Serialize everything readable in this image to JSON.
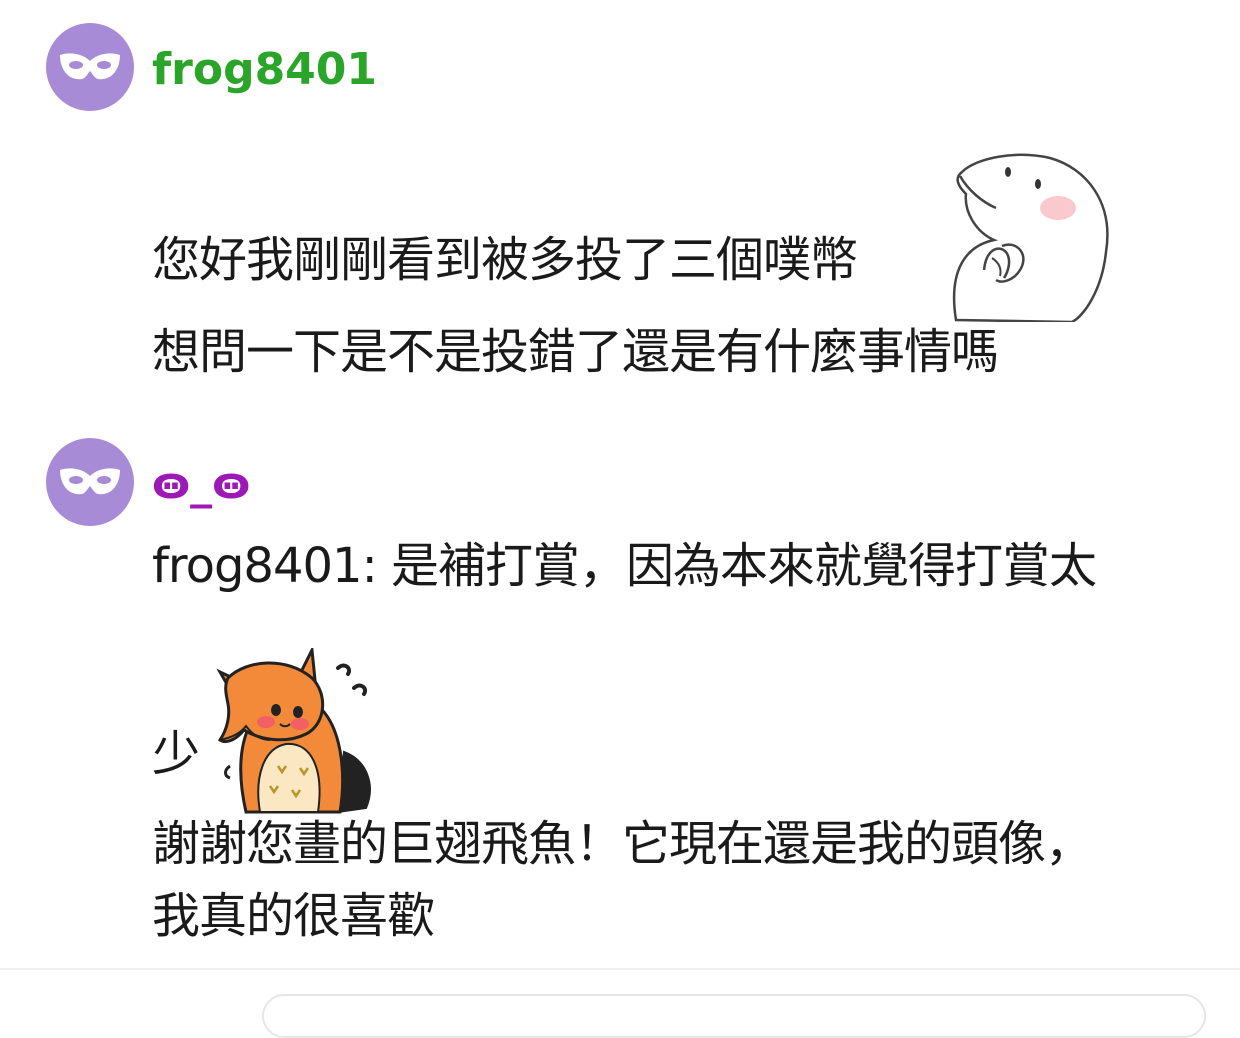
{
  "messages": [
    {
      "username": "frog8401",
      "username_color": "#2aa52a",
      "avatar_icon": "mask-icon",
      "lines": [
        "您好我剛剛看到被多投了三個噗幣",
        "想問一下是不是投錯了還是有什麼事情嗎"
      ],
      "sticker": "ghost-praying-sticker"
    },
    {
      "username": "ꙫ_ꙫ",
      "username_color": "#9c19b5",
      "avatar_icon": "mask-icon",
      "lines": [
        "frog8401: 是補打賞，因為本來就覺得打賞太",
        "少",
        "謝謝您畫的巨翅飛魚！它現在還是我的頭像，",
        "我真的很喜歡"
      ],
      "sticker": "fox-nervous-sticker"
    }
  ],
  "colors": {
    "avatar_bg": "#a78bd6",
    "text": "#1a1a1a",
    "divider": "#eeeeee"
  }
}
